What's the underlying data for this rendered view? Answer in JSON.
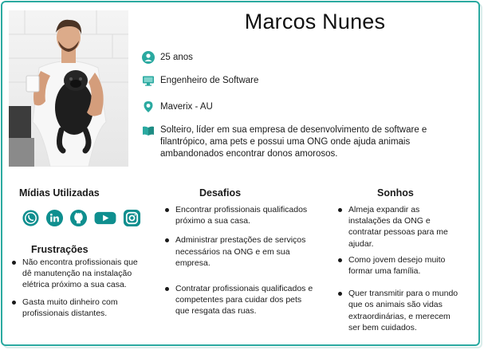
{
  "profile": {
    "name": "Marcos Nunes",
    "age": "25 anos",
    "job": "Engenheiro de Software",
    "location": "Maverix - AU",
    "bio": "Solteiro, líder em sua empresa de desenvolvimento de software e filantrópico, ama pets e possui uma ONG onde ajuda animais ambandonados encontrar donos amorosos."
  },
  "icons": {
    "age": "user-icon",
    "job": "monitor-icon",
    "location": "location-pin-icon",
    "bio": "open-book-icon"
  },
  "colors": {
    "accent": "#2aa9a0",
    "social": "#0f8f8f"
  },
  "medias": {
    "title": "Mídias Utilizadas",
    "items": [
      "whatsapp-icon",
      "linkedin-icon",
      "github-icon",
      "youtube-icon",
      "instagram-icon"
    ]
  },
  "frustracoes": {
    "title": "Frustrações",
    "items": [
      "Não encontra profissionais que dê manutenção na instalação elétrica próximo a sua casa.",
      "Gasta muito dinheiro com profissionais distantes."
    ]
  },
  "desafios": {
    "title": "Desafios",
    "items": [
      "Encontrar profissionais qualificados próximo a sua casa.",
      "Administrar prestações de serviços necessários na ONG e em sua empresa.",
      "Contratar profissionais qualificados e competentes para cuidar dos pets que resgata das ruas."
    ]
  },
  "sonhos": {
    "title": "Sonhos",
    "items": [
      "Almeja expandir as instalações da ONG e contratar pessoas para me ajudar.",
      "Como jovem desejo muito formar uma família.",
      "Quer transmitir para o mundo que os animais são vidas extraordinárias, e merecem ser bem cuidados."
    ]
  }
}
